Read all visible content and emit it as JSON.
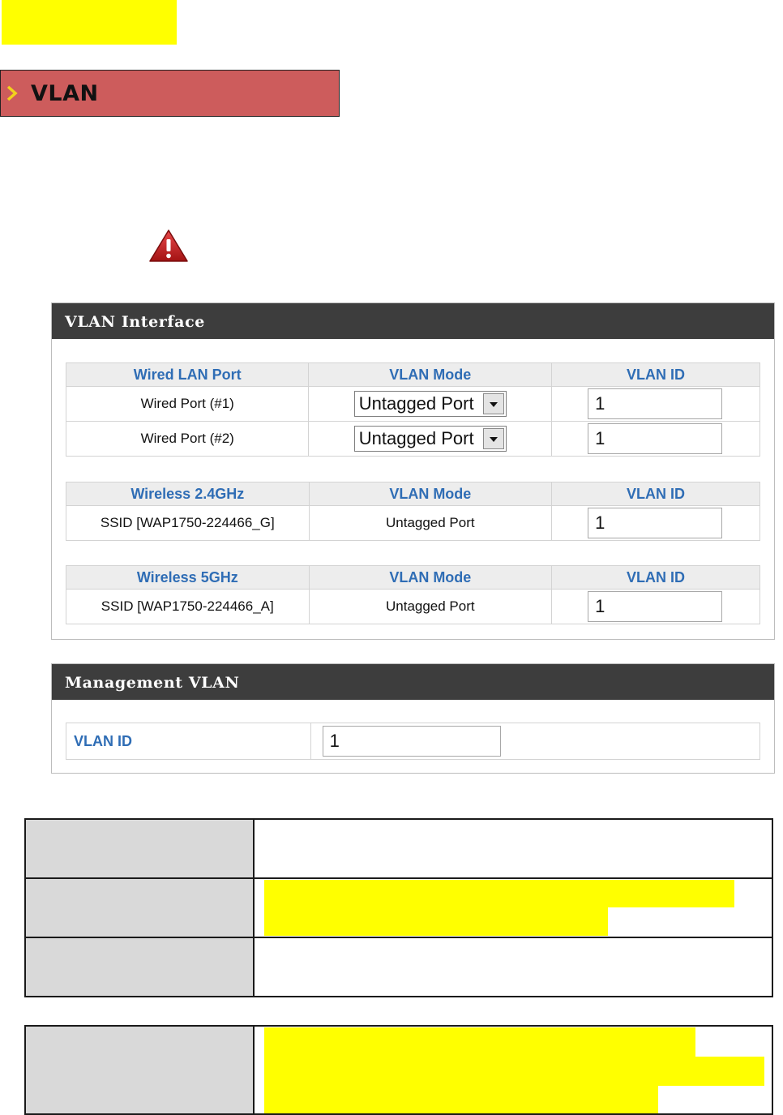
{
  "banner": {
    "title": "VLAN"
  },
  "colors": {
    "banner_bg": "#cd5c5c",
    "highlight": "#ffff00",
    "panel_header": "#3d3d3d",
    "header_text_blue": "#2f6db5"
  },
  "icons": {
    "chevron": "chevron-right-icon",
    "warning": "warning-triangle-icon"
  },
  "vlan_interface": {
    "title": "VLAN Interface",
    "wired": {
      "headers": [
        "Wired LAN Port",
        "VLAN Mode",
        "VLAN ID"
      ],
      "rows": [
        {
          "port": "Wired Port (#1)",
          "mode": "Untagged Port",
          "vlan_id": "1"
        },
        {
          "port": "Wired Port (#2)",
          "mode": "Untagged Port",
          "vlan_id": "1"
        }
      ]
    },
    "wireless24": {
      "headers": [
        "Wireless 2.4GHz",
        "VLAN Mode",
        "VLAN ID"
      ],
      "rows": [
        {
          "ssid": "SSID [WAP1750-224466_G]",
          "mode": "Untagged Port",
          "vlan_id": "1"
        }
      ]
    },
    "wireless5": {
      "headers": [
        "Wireless 5GHz",
        "VLAN Mode",
        "VLAN ID"
      ],
      "rows": [
        {
          "ssid": "SSID [WAP1750-224466_A]",
          "mode": "Untagged Port",
          "vlan_id": "1"
        }
      ]
    }
  },
  "management_vlan": {
    "title": "Management VLAN",
    "label": "VLAN ID",
    "value": "1"
  }
}
